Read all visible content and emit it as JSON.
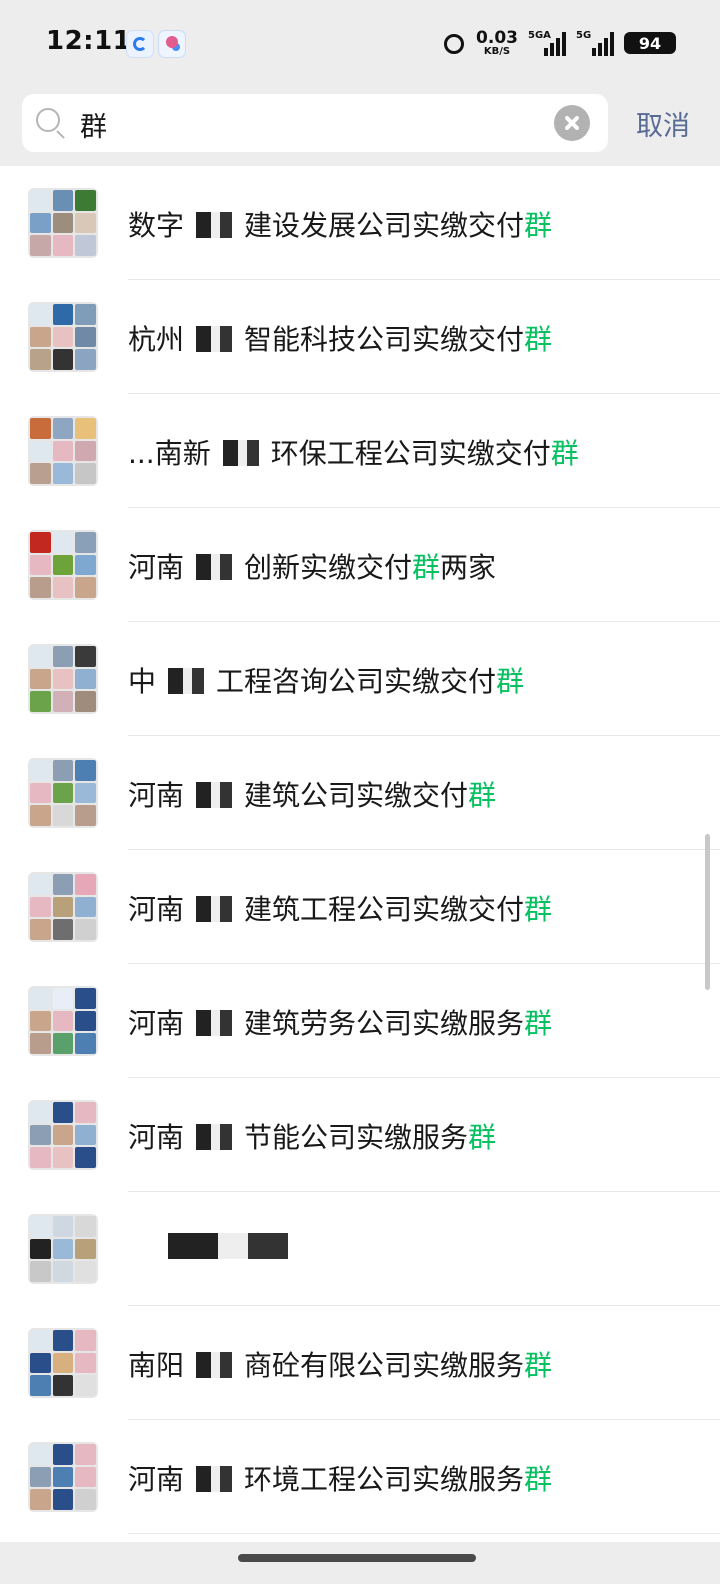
{
  "status_bar": {
    "time": "12:11",
    "net_speed_value": "0.03",
    "net_speed_unit": "KB/S",
    "signal1_label": "5GA",
    "signal2_label": "5G",
    "battery": "94"
  },
  "search": {
    "query": "群",
    "cancel_label": "取消"
  },
  "results": [
    {
      "before": "数字",
      "after": "建设发展公司实缴交付",
      "highlight": "群",
      "tail": "",
      "avatar": [
        "#dfe8ef",
        "#6a8fb5",
        "#3d7a34",
        "#7aa0c8",
        "#9c8d7d",
        "#d9c7b8",
        "#c7a8a8",
        "#e6b8c2",
        "#c0c8d8"
      ]
    },
    {
      "before": "杭州",
      "after": "智能科技公司实缴交付",
      "highlight": "群",
      "tail": "",
      "avatar": [
        "#dfe8ef",
        "#2f6aa8",
        "#7f9db8",
        "#c9a58c",
        "#e8c2c2",
        "#6f89a6",
        "#b8a28a",
        "#333",
        "#8aa4c2"
      ]
    },
    {
      "before": "...南新",
      "after": "环保工程公司实缴交付",
      "highlight": "群",
      "tail": "",
      "avatar": [
        "#c96c3c",
        "#8fa6c2",
        "#e8c07a",
        "#dfe8ef",
        "#e6b8c2",
        "#d0a8b0",
        "#b99f8f",
        "#9ab8d8",
        "#c6c6c6"
      ]
    },
    {
      "before": "河南",
      "after": "创新实缴交付",
      "highlight": "群",
      "tail": "两家",
      "avatar": [
        "#c2281f",
        "#dfe8ef",
        "#8aa0b8",
        "#e6b8c2",
        "#6ea33a",
        "#7fa8d0",
        "#b89c8c",
        "#e8c2c2",
        "#c9a58c"
      ]
    },
    {
      "before": "中",
      "after": "工程咨询公司实缴交付",
      "highlight": "群",
      "tail": "",
      "avatar": [
        "#dfe8ef",
        "#8c9eb3",
        "#3a3a3a",
        "#c9a58c",
        "#e8c2c2",
        "#8fb0d0",
        "#6aa34a",
        "#d2b0b8",
        "#a08c7c"
      ]
    },
    {
      "before": "河南",
      "after": "建筑公司实缴交付",
      "highlight": "群",
      "tail": "",
      "avatar": [
        "#dfe8ef",
        "#8c9eb3",
        "#4d7fb3",
        "#e6b8c2",
        "#6aa34a",
        "#9ab8d8",
        "#c9a58c",
        "#d8d8d8",
        "#b89c8c"
      ]
    },
    {
      "before": "河南",
      "after": "建筑工程公司实缴交付",
      "highlight": "群",
      "tail": "",
      "avatar": [
        "#dfe8ef",
        "#8c9eb3",
        "#e6a8b8",
        "#e6b8c2",
        "#b8a07a",
        "#8fb0d0",
        "#c9a58c",
        "#6e6e6e",
        "#d0d0d0"
      ]
    },
    {
      "before": "河南",
      "after": "建筑劳务公司实缴服务",
      "highlight": "群",
      "tail": "",
      "avatar": [
        "#dfe8ef",
        "#e8eef6",
        "#2a4e8a",
        "#c9a58c",
        "#e6b8c2",
        "#2a4e8a",
        "#b89c8c",
        "#5aa06a",
        "#4d7fb3"
      ]
    },
    {
      "before": "河南",
      "after": "节能公司实缴服务",
      "highlight": "群",
      "tail": "",
      "avatar": [
        "#dfe8ef",
        "#2a4e8a",
        "#e6b8c2",
        "#8c9eb3",
        "#c9a58c",
        "#8fb0d0",
        "#e6b8c2",
        "#e8c2c2",
        "#2a4e8a"
      ]
    },
    {
      "before": "",
      "after": "",
      "highlight": "",
      "tail": "",
      "avatar": [
        "#dfe8ef",
        "#cfd8e2",
        "#d8d8d8",
        "#222",
        "#9ab8d8",
        "#b8a07a",
        "#c8c8c8",
        "#d0d8e0",
        "#e0e0e0"
      ]
    },
    {
      "before": "南阳",
      "after": "商砼有限公司实缴服务",
      "highlight": "群",
      "tail": "",
      "avatar": [
        "#dfe8ef",
        "#2a4e8a",
        "#e6b8c2",
        "#2a4e8a",
        "#d8b080",
        "#e6b8c2",
        "#4d7fb3",
        "#333",
        "#e0e0e0"
      ]
    },
    {
      "before": "河南",
      "after": "环境工程公司实缴服务",
      "highlight": "群",
      "tail": "",
      "avatar": [
        "#dfe8ef",
        "#2a4e8a",
        "#e6b8c2",
        "#8c9eb3",
        "#4d7fb3",
        "#e6b8c2",
        "#c9a58c",
        "#2a4e8a",
        "#d0d0d0"
      ]
    }
  ],
  "colors": {
    "highlight": "#07c160",
    "cancel": "#576b95",
    "background": "#ededed"
  }
}
